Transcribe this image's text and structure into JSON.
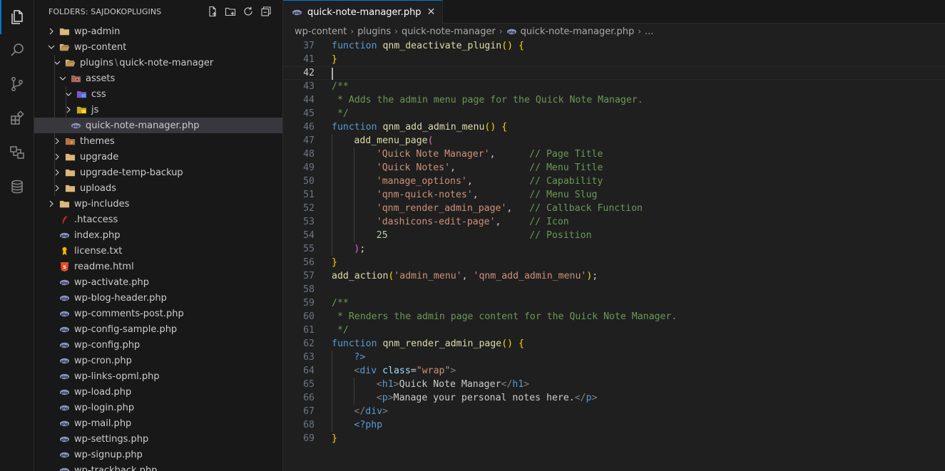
{
  "activity_bar": {
    "icons": [
      "explorer-icon",
      "search-icon",
      "source-control-icon",
      "extensions-icon",
      "remote-explorer-icon",
      "database-icon"
    ]
  },
  "sidebar": {
    "title": "FOLDERS: SAJDOKOPLUGINS",
    "tree": [
      {
        "label": "wp-admin",
        "type": "folder",
        "open": false
      },
      {
        "label": "wp-content",
        "type": "folder",
        "open": true
      },
      {
        "label": "plugins",
        "label2": "quick-note-manager",
        "type": "folder",
        "open": true
      },
      {
        "label": "assets",
        "type": "folder-assets",
        "open": true
      },
      {
        "label": "css",
        "type": "folder-css",
        "open": true
      },
      {
        "label": "js",
        "type": "folder-js",
        "open": false
      },
      {
        "label": "quick-note-manager.php",
        "type": "php",
        "selected": true
      },
      {
        "label": "themes",
        "type": "folder-themes",
        "open": false
      },
      {
        "label": "upgrade",
        "type": "folder",
        "open": false
      },
      {
        "label": "upgrade-temp-backup",
        "type": "folder",
        "open": false
      },
      {
        "label": "uploads",
        "type": "folder",
        "open": false
      },
      {
        "label": "wp-includes",
        "type": "folder",
        "open": false
      },
      {
        "label": ".htaccess",
        "type": "htaccess"
      },
      {
        "label": "index.php",
        "type": "php"
      },
      {
        "label": "license.txt",
        "type": "license"
      },
      {
        "label": "readme.html",
        "type": "html"
      },
      {
        "label": "wp-activate.php",
        "type": "php"
      },
      {
        "label": "wp-blog-header.php",
        "type": "php"
      },
      {
        "label": "wp-comments-post.php",
        "type": "php"
      },
      {
        "label": "wp-config-sample.php",
        "type": "php"
      },
      {
        "label": "wp-config.php",
        "type": "php"
      },
      {
        "label": "wp-cron.php",
        "type": "php"
      },
      {
        "label": "wp-links-opml.php",
        "type": "php"
      },
      {
        "label": "wp-load.php",
        "type": "php"
      },
      {
        "label": "wp-login.php",
        "type": "php"
      },
      {
        "label": "wp-mail.php",
        "type": "php"
      },
      {
        "label": "wp-settings.php",
        "type": "php"
      },
      {
        "label": "wp-signup.php",
        "type": "php"
      },
      {
        "label": "wp-trackback.php",
        "type": "php"
      }
    ]
  },
  "editor": {
    "tab_label": "quick-note-manager.php",
    "breadcrumbs": [
      "wp-content",
      "plugins",
      "quick-note-manager",
      "quick-note-manager.php",
      "..."
    ],
    "current_line": "42",
    "lines": [
      {
        "n": "37",
        "indent": 0,
        "tokens": [
          [
            "kw",
            "function "
          ],
          [
            "fn",
            "qnm_deactivate_plugin"
          ],
          [
            "b1",
            "() {"
          ]
        ]
      },
      {
        "n": "41",
        "indent": 0,
        "tokens": [
          [
            "b1",
            "}"
          ]
        ]
      },
      {
        "n": "42",
        "indent": 0,
        "tokens": []
      },
      {
        "n": "43",
        "indent": 0,
        "tokens": [
          [
            "cm",
            "/**"
          ]
        ]
      },
      {
        "n": "44",
        "indent": 0,
        "tokens": [
          [
            "cm",
            " * Adds the admin menu page for the Quick Note Manager."
          ]
        ]
      },
      {
        "n": "45",
        "indent": 0,
        "tokens": [
          [
            "cm",
            " */"
          ]
        ]
      },
      {
        "n": "46",
        "indent": 0,
        "tokens": [
          [
            "kw",
            "function "
          ],
          [
            "fn",
            "qnm_add_admin_menu"
          ],
          [
            "b1",
            "() {"
          ]
        ]
      },
      {
        "n": "47",
        "indent": 1,
        "tokens": [
          [
            "fn",
            "add_menu_page"
          ],
          [
            "b2",
            "("
          ]
        ]
      },
      {
        "n": "48",
        "indent": 2,
        "tokens": [
          [
            "str",
            "'Quick Note Manager'"
          ],
          [
            "plain",
            ",      "
          ],
          [
            "cm",
            "// Page Title"
          ]
        ]
      },
      {
        "n": "49",
        "indent": 2,
        "tokens": [
          [
            "str",
            "'Quick Notes'"
          ],
          [
            "plain",
            ",             "
          ],
          [
            "cm",
            "// Menu Title"
          ]
        ]
      },
      {
        "n": "50",
        "indent": 2,
        "tokens": [
          [
            "str",
            "'manage_options'"
          ],
          [
            "plain",
            ",          "
          ],
          [
            "cm",
            "// Capability"
          ]
        ]
      },
      {
        "n": "51",
        "indent": 2,
        "tokens": [
          [
            "str",
            "'qnm-quick-notes'"
          ],
          [
            "plain",
            ",         "
          ],
          [
            "cm",
            "// Menu Slug"
          ]
        ]
      },
      {
        "n": "52",
        "indent": 2,
        "tokens": [
          [
            "str",
            "'qnm_render_admin_page'"
          ],
          [
            "plain",
            ",   "
          ],
          [
            "cm",
            "// Callback Function"
          ]
        ]
      },
      {
        "n": "53",
        "indent": 2,
        "tokens": [
          [
            "str",
            "'dashicons-edit-page'"
          ],
          [
            "plain",
            ",     "
          ],
          [
            "cm",
            "// Icon"
          ]
        ]
      },
      {
        "n": "54",
        "indent": 2,
        "tokens": [
          [
            "num",
            "25"
          ],
          [
            "plain",
            "                         "
          ],
          [
            "cm",
            "// Position"
          ]
        ]
      },
      {
        "n": "55",
        "indent": 1,
        "tokens": [
          [
            "b2",
            ")"
          ],
          [
            "plain",
            ";"
          ]
        ]
      },
      {
        "n": "56",
        "indent": 0,
        "tokens": [
          [
            "b1",
            "}"
          ]
        ]
      },
      {
        "n": "57",
        "indent": 0,
        "tokens": [
          [
            "fn",
            "add_action"
          ],
          [
            "b1",
            "("
          ],
          [
            "str",
            "'admin_menu'"
          ],
          [
            "plain",
            ", "
          ],
          [
            "str",
            "'qnm_add_admin_menu'"
          ],
          [
            "b1",
            ")"
          ],
          [
            "plain",
            ";"
          ]
        ]
      },
      {
        "n": "58",
        "indent": 0,
        "tokens": []
      },
      {
        "n": "59",
        "indent": 0,
        "tokens": [
          [
            "cm",
            "/**"
          ]
        ]
      },
      {
        "n": "60",
        "indent": 0,
        "tokens": [
          [
            "cm",
            " * Renders the admin page content for the Quick Note Manager."
          ]
        ]
      },
      {
        "n": "61",
        "indent": 0,
        "tokens": [
          [
            "cm",
            " */"
          ]
        ]
      },
      {
        "n": "62",
        "indent": 0,
        "tokens": [
          [
            "kw",
            "function "
          ],
          [
            "fn",
            "qnm_render_admin_page"
          ],
          [
            "b1",
            "() {"
          ]
        ]
      },
      {
        "n": "63",
        "indent": 1,
        "tokens": [
          [
            "php",
            "?>"
          ]
        ]
      },
      {
        "n": "64",
        "indent": 1,
        "tokens": [
          [
            "tb",
            "<"
          ],
          [
            "tag",
            "div "
          ],
          [
            "attr",
            "class"
          ],
          [
            "plain",
            "="
          ],
          [
            "str",
            "\"wrap\""
          ],
          [
            "tb",
            ">"
          ]
        ]
      },
      {
        "n": "65",
        "indent": 2,
        "tokens": [
          [
            "tb",
            "<"
          ],
          [
            "tag",
            "h1"
          ],
          [
            "tb",
            ">"
          ],
          [
            "plain",
            "Quick Note Manager"
          ],
          [
            "tb",
            "</"
          ],
          [
            "tag",
            "h1"
          ],
          [
            "tb",
            ">"
          ]
        ]
      },
      {
        "n": "66",
        "indent": 2,
        "tokens": [
          [
            "tb",
            "<"
          ],
          [
            "tag",
            "p"
          ],
          [
            "tb",
            ">"
          ],
          [
            "plain",
            "Manage your personal notes here."
          ],
          [
            "tb",
            "</"
          ],
          [
            "tag",
            "p"
          ],
          [
            "tb",
            ">"
          ]
        ]
      },
      {
        "n": "67",
        "indent": 1,
        "tokens": [
          [
            "tb",
            "</"
          ],
          [
            "tag",
            "div"
          ],
          [
            "tb",
            ">"
          ]
        ]
      },
      {
        "n": "68",
        "indent": 1,
        "tokens": [
          [
            "php",
            "<?php"
          ]
        ]
      },
      {
        "n": "69",
        "indent": 0,
        "tokens": [
          [
            "b1",
            "}"
          ]
        ]
      }
    ]
  },
  "colors": {
    "accent": "#0078d4",
    "folder": "#dcb67a",
    "php": "#8892bf",
    "html": "#e44d26"
  }
}
